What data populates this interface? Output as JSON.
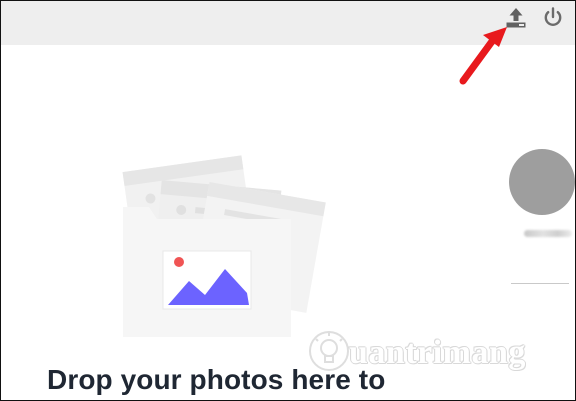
{
  "header": {
    "upload_icon": "upload-icon",
    "power_icon": "power-icon"
  },
  "annotation": {
    "arrow_color": "#e8191d"
  },
  "profile": {
    "avatar_color": "#9e9e9e"
  },
  "dropzone": {
    "headline": "Drop your photos here to",
    "illustration_accent": "#6c63ff",
    "dot_color": "#f05454"
  },
  "watermark": {
    "text": "uantrimang"
  }
}
